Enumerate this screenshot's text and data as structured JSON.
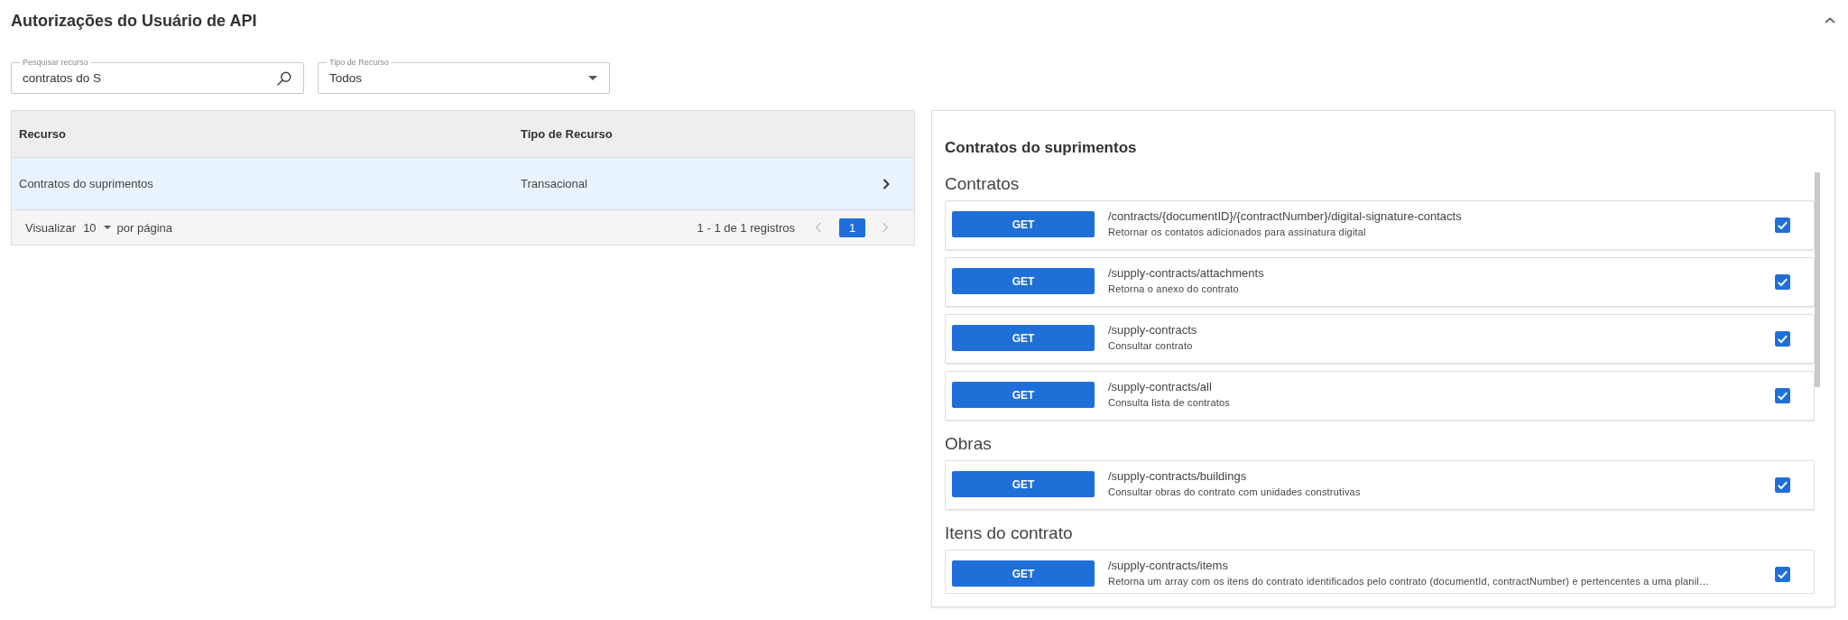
{
  "header": {
    "title": "Autorizações do Usuário de API",
    "expanded": true
  },
  "filters": {
    "search": {
      "label": "Pesquisar recurso",
      "value": "contratos do S"
    },
    "resource_type": {
      "label": "Tipo de Recurso",
      "value": "Todos"
    }
  },
  "table": {
    "columns": [
      "Recurso",
      "Tipo de Recurso"
    ],
    "rows": [
      {
        "resource": "Contratos do suprimentos",
        "type": "Transacional",
        "selected": true
      }
    ],
    "footer": {
      "show_label": "Visualizar",
      "page_size": "10",
      "per_page_label": "por página",
      "range": "1 - 1 de 1 registros",
      "previous_disabled": true,
      "next_disabled": true,
      "pages": [
        {
          "label": "1",
          "selected": true
        }
      ]
    }
  },
  "detail": {
    "title": "Contratos do suprimentos",
    "groups": [
      {
        "name": "Contratos",
        "endpoints": [
          {
            "method": "GET",
            "path": "/contracts/{documentID}/{contractNumber}/digital-signature-contacts",
            "description": "Retornar os contatos adicionados para assinatura digital",
            "checked": true
          },
          {
            "method": "GET",
            "path": "/supply-contracts/attachments",
            "description": "Retorna o anexo do contrato",
            "checked": true
          },
          {
            "method": "GET",
            "path": "/supply-contracts",
            "description": "Consultar contrato",
            "checked": true
          },
          {
            "method": "GET",
            "path": "/supply-contracts/all",
            "description": "Consulta lista de contratos",
            "checked": true
          }
        ]
      },
      {
        "name": "Obras",
        "endpoints": [
          {
            "method": "GET",
            "path": "/supply-contracts/buildings",
            "description": "Consultar obras do contrato com unidades construtivas",
            "checked": true
          }
        ]
      },
      {
        "name": "Itens do contrato",
        "endpoints": [
          {
            "method": "GET",
            "path": "/supply-contracts/items",
            "description": "Retorna um array com os itens do contrato identificados pelo contrato (documentId, contractNumber) e pertencentes a uma planil…",
            "checked": true
          }
        ]
      }
    ]
  }
}
